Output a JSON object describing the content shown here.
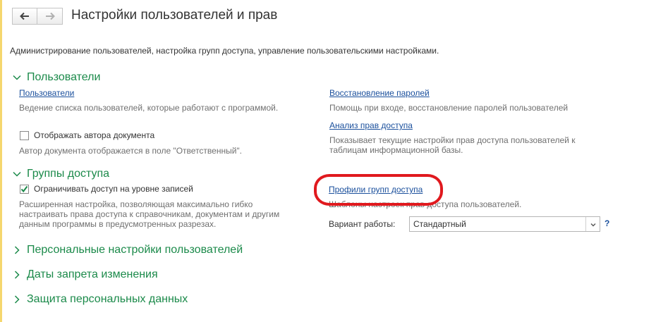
{
  "window": {
    "title": "Настройки пользователей и прав",
    "subtitle": "Администрирование пользователей, настройка групп доступа, управление пользовательскими настройками."
  },
  "icons": {
    "back": "arrow-left-icon",
    "forward": "arrow-right-icon"
  },
  "sections": {
    "users": {
      "title": "Пользователи",
      "users_link": "Пользователи",
      "users_desc": "Ведение списка пользователей, которые работают с программой.",
      "show_author_label": "Отображать автора документа",
      "show_author_checked": false,
      "show_author_desc": "Автор документа отображается в поле \"Ответственный\".",
      "password_link": "Восстановление паролей",
      "password_desc": "Помощь при входе, восстановление паролей пользователей",
      "rights_link": "Анализ прав доступа",
      "rights_desc": "Показывает текущие настройки прав доступа пользователей к таблицам информационной базы."
    },
    "groups": {
      "title": "Группы доступа",
      "restrict_label": "Ограничивать доступ на уровне записей",
      "restrict_checked": true,
      "restrict_desc": "Расширенная настройка, позволяющая максимально гибко настраивать права доступа к справочникам, документам и другим данным программы в предусмотренных разрезах.",
      "profiles_link": "Профили групп доступа",
      "profiles_desc": "Шаблоны настроек прав доступа пользователей.",
      "mode_label": "Вариант работы:",
      "mode_value": "Стандартный",
      "help": "?"
    },
    "personal": {
      "title": "Персональные настройки пользователей"
    },
    "dates": {
      "title": "Даты запрета изменения"
    },
    "privacy": {
      "title": "Защита персональных данных"
    }
  },
  "colors": {
    "accent_green": "#1b8a4a",
    "link_blue": "#1a4f9c",
    "highlight_red": "#e0191e"
  }
}
